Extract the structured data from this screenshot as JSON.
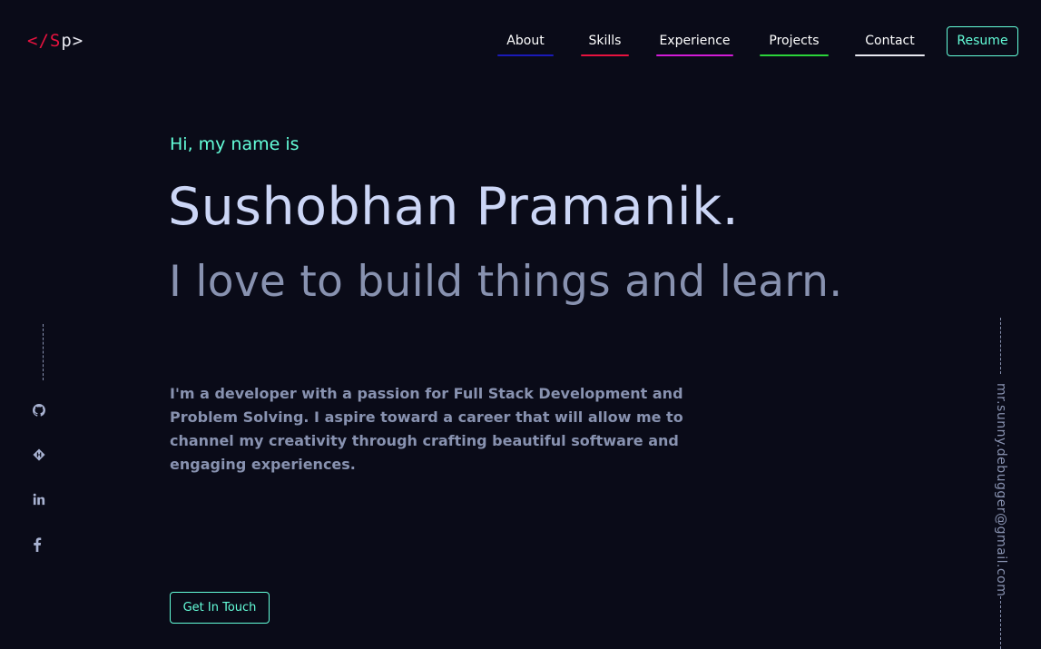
{
  "logo": {
    "open": "</",
    "s": "S",
    "p": "p",
    "close": ">"
  },
  "nav": {
    "items": [
      {
        "label": "About",
        "underline_color": "#1a1ab8"
      },
      {
        "label": "Skills",
        "underline_color": "#e8123f"
      },
      {
        "label": "Experience",
        "underline_color": "#d21bd6"
      },
      {
        "label": "Projects",
        "underline_color": "#2bd43a"
      },
      {
        "label": "Contact",
        "underline_color": "#e8e8f0"
      }
    ],
    "resume_label": "Resume"
  },
  "hero": {
    "greeting": "Hi, my name is",
    "name": "Sushobhan Pramanik.",
    "tagline": "I love to build things and learn.",
    "bio": "I'm a developer with a passion for Full Stack Development and Problem Solving. I aspire toward a career that will allow me to channel my creativity through crafting beautiful software and engaging experiences.",
    "cta_label": "Get In Touch"
  },
  "social": {
    "icons": [
      "github-icon",
      "hashnode-icon",
      "linkedin-icon",
      "facebook-icon"
    ]
  },
  "email": "mr.sunny.debugger@gmail.com",
  "colors": {
    "background": "#0a0b18",
    "accent": "#64ffda",
    "heading": "#ccd6f6",
    "text": "#8892b0",
    "logo_red": "#e8123f"
  }
}
